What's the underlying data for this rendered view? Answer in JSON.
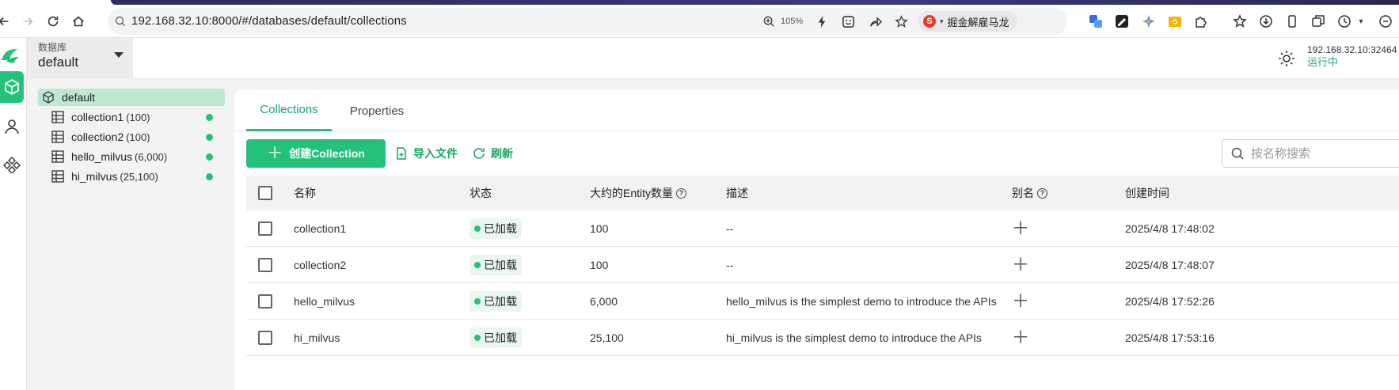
{
  "browser": {
    "url": "192.168.32.10:8000/#/databases/default/collections",
    "zoom": "105%",
    "search_engine": "掘金解雇马龙"
  },
  "header": {
    "db_label": "数据库",
    "db_value": "default",
    "server_address": "192.168.32.10:32464",
    "server_status": "运行中"
  },
  "tree": {
    "root": "default",
    "items": [
      {
        "name": "collection1",
        "count": "(100)"
      },
      {
        "name": "collection2",
        "count": "(100)"
      },
      {
        "name": "hello_milvus",
        "count": "(6,000)"
      },
      {
        "name": "hi_milvus",
        "count": "(25,100)"
      }
    ]
  },
  "tabs": [
    "Collections",
    "Properties"
  ],
  "actions": {
    "create": "创建Collection",
    "import": "导入文件",
    "refresh": "刷新",
    "search_placeholder": "按名称搜索"
  },
  "table": {
    "headers": {
      "name": "名称",
      "status": "状态",
      "entities": "大约的Entity数量",
      "description": "描述",
      "alias": "别名",
      "created": "创建时间"
    },
    "rows": [
      {
        "name": "collection1",
        "status": "已加载",
        "entities": "100",
        "description": "--",
        "created": "2025/4/8 17:48:02"
      },
      {
        "name": "collection2",
        "status": "已加载",
        "entities": "100",
        "description": "--",
        "created": "2025/4/8 17:48:07"
      },
      {
        "name": "hello_milvus",
        "status": "已加载",
        "entities": "6,000",
        "description": "hello_milvus is the simplest demo to introduce the APIs",
        "created": "2025/4/8 17:52:26"
      },
      {
        "name": "hi_milvus",
        "status": "已加载",
        "entities": "25,100",
        "description": "hi_milvus is the simplest demo to introduce the APIs",
        "created": "2025/4/8 17:53:16"
      }
    ]
  },
  "colors": {
    "accent": "#25c17b",
    "accent_text": "#16a862",
    "tree_selected": "#bfe8d4"
  }
}
